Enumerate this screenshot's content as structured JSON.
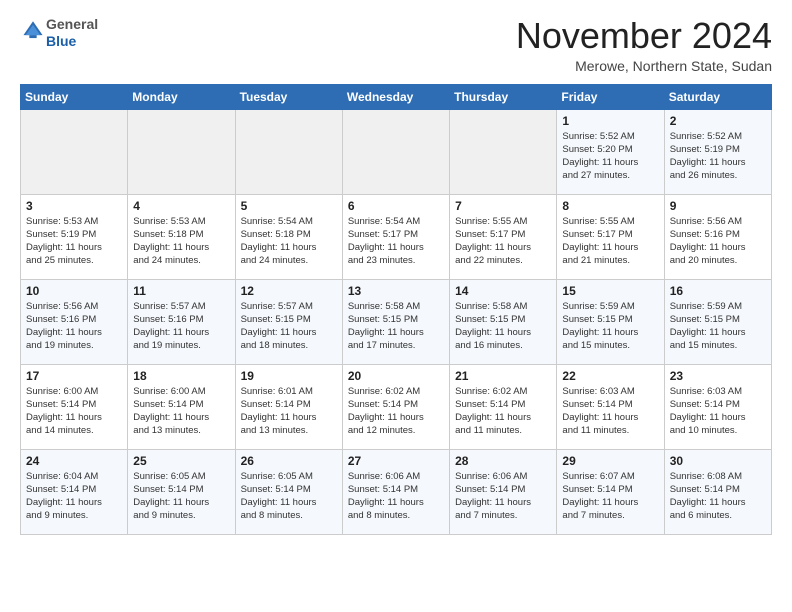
{
  "logo": {
    "general": "General",
    "blue": "Blue"
  },
  "title": "November 2024",
  "location": "Merowe, Northern State, Sudan",
  "weekdays": [
    "Sunday",
    "Monday",
    "Tuesday",
    "Wednesday",
    "Thursday",
    "Friday",
    "Saturday"
  ],
  "weeks": [
    [
      {
        "day": "",
        "info": ""
      },
      {
        "day": "",
        "info": ""
      },
      {
        "day": "",
        "info": ""
      },
      {
        "day": "",
        "info": ""
      },
      {
        "day": "",
        "info": ""
      },
      {
        "day": "1",
        "info": "Sunrise: 5:52 AM\nSunset: 5:20 PM\nDaylight: 11 hours\nand 27 minutes."
      },
      {
        "day": "2",
        "info": "Sunrise: 5:52 AM\nSunset: 5:19 PM\nDaylight: 11 hours\nand 26 minutes."
      }
    ],
    [
      {
        "day": "3",
        "info": "Sunrise: 5:53 AM\nSunset: 5:19 PM\nDaylight: 11 hours\nand 25 minutes."
      },
      {
        "day": "4",
        "info": "Sunrise: 5:53 AM\nSunset: 5:18 PM\nDaylight: 11 hours\nand 24 minutes."
      },
      {
        "day": "5",
        "info": "Sunrise: 5:54 AM\nSunset: 5:18 PM\nDaylight: 11 hours\nand 24 minutes."
      },
      {
        "day": "6",
        "info": "Sunrise: 5:54 AM\nSunset: 5:17 PM\nDaylight: 11 hours\nand 23 minutes."
      },
      {
        "day": "7",
        "info": "Sunrise: 5:55 AM\nSunset: 5:17 PM\nDaylight: 11 hours\nand 22 minutes."
      },
      {
        "day": "8",
        "info": "Sunrise: 5:55 AM\nSunset: 5:17 PM\nDaylight: 11 hours\nand 21 minutes."
      },
      {
        "day": "9",
        "info": "Sunrise: 5:56 AM\nSunset: 5:16 PM\nDaylight: 11 hours\nand 20 minutes."
      }
    ],
    [
      {
        "day": "10",
        "info": "Sunrise: 5:56 AM\nSunset: 5:16 PM\nDaylight: 11 hours\nand 19 minutes."
      },
      {
        "day": "11",
        "info": "Sunrise: 5:57 AM\nSunset: 5:16 PM\nDaylight: 11 hours\nand 19 minutes."
      },
      {
        "day": "12",
        "info": "Sunrise: 5:57 AM\nSunset: 5:15 PM\nDaylight: 11 hours\nand 18 minutes."
      },
      {
        "day": "13",
        "info": "Sunrise: 5:58 AM\nSunset: 5:15 PM\nDaylight: 11 hours\nand 17 minutes."
      },
      {
        "day": "14",
        "info": "Sunrise: 5:58 AM\nSunset: 5:15 PM\nDaylight: 11 hours\nand 16 minutes."
      },
      {
        "day": "15",
        "info": "Sunrise: 5:59 AM\nSunset: 5:15 PM\nDaylight: 11 hours\nand 15 minutes."
      },
      {
        "day": "16",
        "info": "Sunrise: 5:59 AM\nSunset: 5:15 PM\nDaylight: 11 hours\nand 15 minutes."
      }
    ],
    [
      {
        "day": "17",
        "info": "Sunrise: 6:00 AM\nSunset: 5:14 PM\nDaylight: 11 hours\nand 14 minutes."
      },
      {
        "day": "18",
        "info": "Sunrise: 6:00 AM\nSunset: 5:14 PM\nDaylight: 11 hours\nand 13 minutes."
      },
      {
        "day": "19",
        "info": "Sunrise: 6:01 AM\nSunset: 5:14 PM\nDaylight: 11 hours\nand 13 minutes."
      },
      {
        "day": "20",
        "info": "Sunrise: 6:02 AM\nSunset: 5:14 PM\nDaylight: 11 hours\nand 12 minutes."
      },
      {
        "day": "21",
        "info": "Sunrise: 6:02 AM\nSunset: 5:14 PM\nDaylight: 11 hours\nand 11 minutes."
      },
      {
        "day": "22",
        "info": "Sunrise: 6:03 AM\nSunset: 5:14 PM\nDaylight: 11 hours\nand 11 minutes."
      },
      {
        "day": "23",
        "info": "Sunrise: 6:03 AM\nSunset: 5:14 PM\nDaylight: 11 hours\nand 10 minutes."
      }
    ],
    [
      {
        "day": "24",
        "info": "Sunrise: 6:04 AM\nSunset: 5:14 PM\nDaylight: 11 hours\nand 9 minutes."
      },
      {
        "day": "25",
        "info": "Sunrise: 6:05 AM\nSunset: 5:14 PM\nDaylight: 11 hours\nand 9 minutes."
      },
      {
        "day": "26",
        "info": "Sunrise: 6:05 AM\nSunset: 5:14 PM\nDaylight: 11 hours\nand 8 minutes."
      },
      {
        "day": "27",
        "info": "Sunrise: 6:06 AM\nSunset: 5:14 PM\nDaylight: 11 hours\nand 8 minutes."
      },
      {
        "day": "28",
        "info": "Sunrise: 6:06 AM\nSunset: 5:14 PM\nDaylight: 11 hours\nand 7 minutes."
      },
      {
        "day": "29",
        "info": "Sunrise: 6:07 AM\nSunset: 5:14 PM\nDaylight: 11 hours\nand 7 minutes."
      },
      {
        "day": "30",
        "info": "Sunrise: 6:08 AM\nSunset: 5:14 PM\nDaylight: 11 hours\nand 6 minutes."
      }
    ]
  ]
}
